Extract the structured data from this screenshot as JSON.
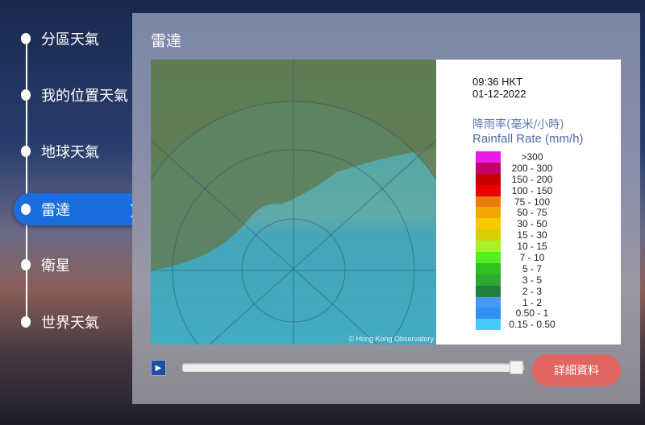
{
  "sidebar": {
    "items": [
      {
        "label": "分區天氣",
        "active": false
      },
      {
        "label": "我的位置天氣",
        "active": false
      },
      {
        "label": "地球天氣",
        "active": false
      },
      {
        "label": "雷達",
        "active": true
      },
      {
        "label": "衛星",
        "active": false
      },
      {
        "label": "世界天氣",
        "active": false
      }
    ],
    "active_chevron": "❯"
  },
  "panel": {
    "title": "雷達",
    "radar": {
      "time": "09:36 HKT",
      "date": "01-12-2022",
      "legend_title_zh": "降雨率(毫米/小時)",
      "legend_title_en": "Rainfall Rate (mm/h)",
      "scale": [
        {
          "label": ">300",
          "color": "#e81ce8"
        },
        {
          "label": "200 - 300",
          "color": "#c2006a"
        },
        {
          "label": "150 - 200",
          "color": "#c80000"
        },
        {
          "label": "100 - 150",
          "color": "#e80000"
        },
        {
          "label": "75 - 100",
          "color": "#ee7a10"
        },
        {
          "label": "50 - 75",
          "color": "#f0a800"
        },
        {
          "label": "30 - 50",
          "color": "#f8c800"
        },
        {
          "label": "15 - 30",
          "color": "#d8d000"
        },
        {
          "label": "10 - 15",
          "color": "#a8f028"
        },
        {
          "label": "7 - 10",
          "color": "#50f020"
        },
        {
          "label": "5 - 7",
          "color": "#30c020"
        },
        {
          "label": "3 - 5",
          "color": "#30a830"
        },
        {
          "label": "2 - 3",
          "color": "#208040"
        },
        {
          "label": "1 - 2",
          "color": "#4898f8"
        },
        {
          "label": "0.50 - 1",
          "color": "#3090f0"
        },
        {
          "label": "0.15 - 0.50",
          "color": "#48c8f8"
        }
      ],
      "copyright": "© Hong Kong Observatory"
    },
    "player": {
      "play_icon": "play-icon",
      "progress_percent": 100
    },
    "details_label": "詳細資料"
  }
}
